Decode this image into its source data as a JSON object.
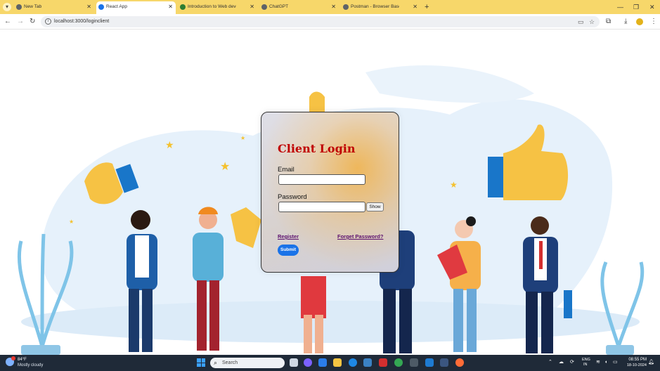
{
  "browser": {
    "tabs": [
      {
        "label": "New Tab",
        "active": false,
        "favicon_color": "#5f6368"
      },
      {
        "label": "React App",
        "active": true,
        "favicon_color": "#1a73e8"
      },
      {
        "label": "Introduction to Web developm",
        "active": false,
        "favicon_color": "#2e7d32"
      },
      {
        "label": "ChatGPT",
        "active": false,
        "favicon_color": "#5f6368"
      },
      {
        "label": "Postman - Browser Based Auth",
        "active": false,
        "favicon_color": "#5f6368"
      }
    ],
    "url": "localhost:3000/loginclient",
    "tab_close_glyph": "✕",
    "new_tab_glyph": "+",
    "tabbar_color": "#f7d76a"
  },
  "login": {
    "title": "Client Login",
    "email_label": "Email",
    "email_value": "",
    "password_label": "Password",
    "password_value": "",
    "show_label": "Show",
    "register_label": "Register",
    "forgot_label": "Forget Password?",
    "submit_label": "Submit",
    "title_color": "#c00000",
    "link_color": "#5b0e6d",
    "submit_color": "#1a73e8"
  },
  "taskbar": {
    "weather_temp": "84°F",
    "weather_desc": "Mostly cloudy",
    "search_placeholder": "Search",
    "lang_line1": "ENG",
    "lang_line2": "IN",
    "time": "08:55 PM",
    "date": "18-10-2024"
  }
}
